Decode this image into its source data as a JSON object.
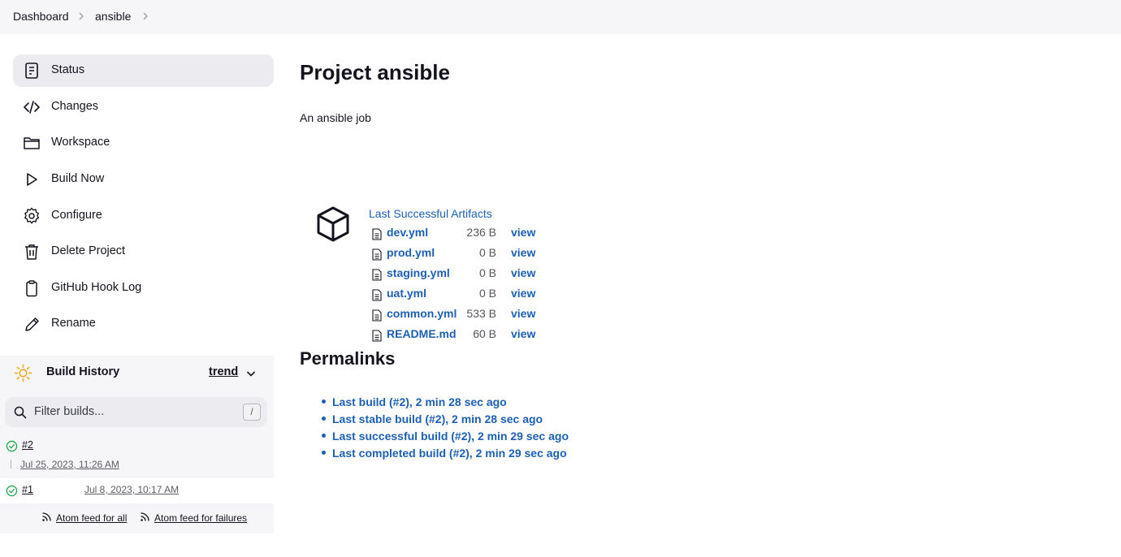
{
  "breadcrumb": [
    "Dashboard",
    "ansible"
  ],
  "sidebar": {
    "tasks": [
      {
        "label": "Status",
        "icon": "status-icon"
      },
      {
        "label": "Changes",
        "icon": "code-icon"
      },
      {
        "label": "Workspace",
        "icon": "folder-icon"
      },
      {
        "label": "Build Now",
        "icon": "play-icon"
      },
      {
        "label": "Configure",
        "icon": "gear-icon"
      },
      {
        "label": "Delete Project",
        "icon": "trash-icon"
      },
      {
        "label": "GitHub Hook Log",
        "icon": "clipboard-icon"
      },
      {
        "label": "Rename",
        "icon": "pencil-icon"
      }
    ]
  },
  "build_history": {
    "title": "Build History",
    "trend": "trend",
    "filter_placeholder": "Filter builds...",
    "shortcut": "/",
    "builds": [
      {
        "number": "#2",
        "date": "Jul 25, 2023, 11:26 AM",
        "status": "success"
      },
      {
        "number": "#1",
        "date": "Jul 8, 2023, 10:17 AM",
        "status": "success"
      }
    ],
    "feeds": [
      "Atom feed for all",
      "Atom feed for failures"
    ]
  },
  "main": {
    "title": "Project ansible",
    "description": "An ansible job",
    "artifacts": {
      "heading": "Last Successful Artifacts",
      "view_label": "view",
      "files": [
        {
          "name": "dev.yml",
          "size": "236 B"
        },
        {
          "name": "prod.yml",
          "size": "0 B"
        },
        {
          "name": "staging.yml",
          "size": "0 B"
        },
        {
          "name": "uat.yml",
          "size": "0 B"
        },
        {
          "name": "common.yml",
          "size": "533 B"
        },
        {
          "name": "README.md",
          "size": "60 B"
        }
      ]
    },
    "permalinks": {
      "title": "Permalinks",
      "links": [
        "Last build (#2), 2 min 28 sec ago",
        "Last stable build (#2), 2 min 28 sec ago",
        "Last successful build (#2), 2 min 29 sec ago",
        "Last completed build (#2), 2 min 29 sec ago"
      ]
    }
  },
  "colors": {
    "link": "#1c5fb5",
    "success": "#1ea64b",
    "sun": "#f0a81e"
  }
}
